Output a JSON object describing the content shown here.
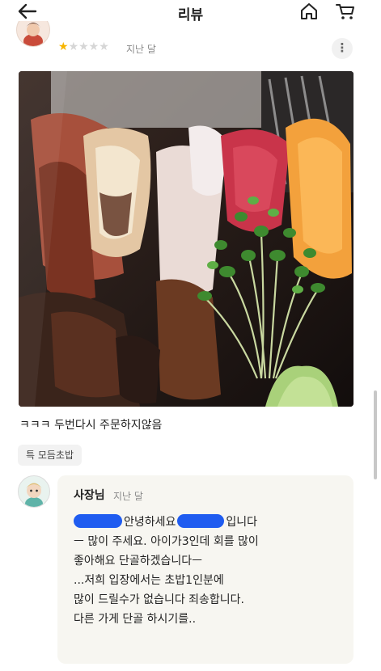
{
  "header": {
    "title": "리뷰",
    "icons": [
      "back-arrow-icon",
      "home-icon",
      "cart-icon"
    ]
  },
  "review": {
    "rating": 1,
    "rating_max": 5,
    "date": "지난 달",
    "more_label": "⋮",
    "text": "ㅋㅋㅋ  두번다시 주문하지않음",
    "menu_tag": "특 모듬초밥"
  },
  "owner_reply": {
    "name": "사장님",
    "date": "지난 달",
    "line1_mid": "안녕하세요",
    "line1_end": "입니다",
    "line2": "ㅡ 많이 주세요. 아이가3인데 회를 많이",
    "line3": "좋아해요 단골하겠습니다ㅡ",
    "line4": "...저희 입장에서는 초밥1인분에",
    "line5": "많이 드릴수가 없습니다 죄송합니다.",
    "line6": "다른 가게 단골 하시기를.."
  },
  "colors": {
    "star_on": "#f7b500",
    "star_off": "#d6d6d6",
    "scribble": "#1f5cf0",
    "reply_bg": "#f7f6f1"
  }
}
